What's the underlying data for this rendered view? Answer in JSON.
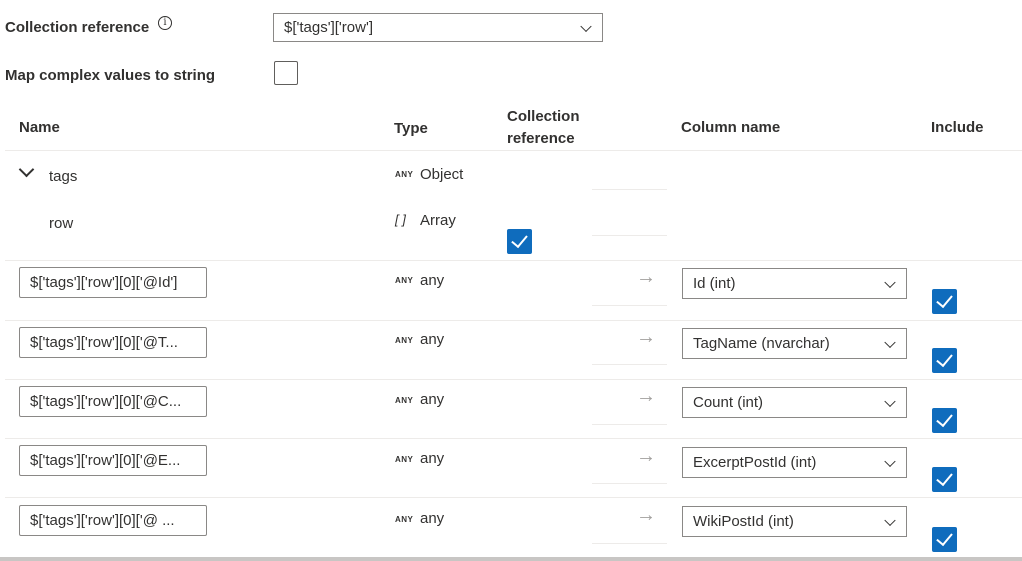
{
  "collection_reference": {
    "label": "Collection reference",
    "info_icon": "info-icon",
    "value": "$['tags']['row']"
  },
  "map_complex": {
    "label": "Map complex values to string",
    "checked": false
  },
  "table": {
    "headers": {
      "name": "Name",
      "type": "Type",
      "collection_ref_line1": "Collection",
      "collection_ref_line2": "reference",
      "column_name": "Column name",
      "include": "Include"
    },
    "tree": [
      {
        "name": "tags",
        "type_tag": "ANY",
        "type": "Object",
        "expanded": true
      },
      {
        "name": "row",
        "type_tag": "[ ]",
        "type": "Array",
        "collection_reference": true
      }
    ],
    "rows": [
      {
        "path": "$['tags']['row'][0]['@Id']",
        "type_tag": "ANY",
        "type": "any",
        "column": "Id (int)",
        "include": true
      },
      {
        "path": "$['tags']['row'][0]['@T...",
        "type_tag": "ANY",
        "type": "any",
        "column": "TagName (nvarchar)",
        "include": true
      },
      {
        "path": "$['tags']['row'][0]['@C...",
        "type_tag": "ANY",
        "type": "any",
        "column": "Count (int)",
        "include": true
      },
      {
        "path": "$['tags']['row'][0]['@E...",
        "type_tag": "ANY",
        "type": "any",
        "column": "ExcerptPostId (int)",
        "include": true
      },
      {
        "path": "$['tags']['row'][0]['@ ...",
        "type_tag": "ANY",
        "type": "any",
        "column": "WikiPostId (int)",
        "include": true
      }
    ]
  },
  "colors": {
    "accent": "#0f6cbd",
    "text": "#323130",
    "border": "#8a8886",
    "divider": "#edebe9"
  }
}
